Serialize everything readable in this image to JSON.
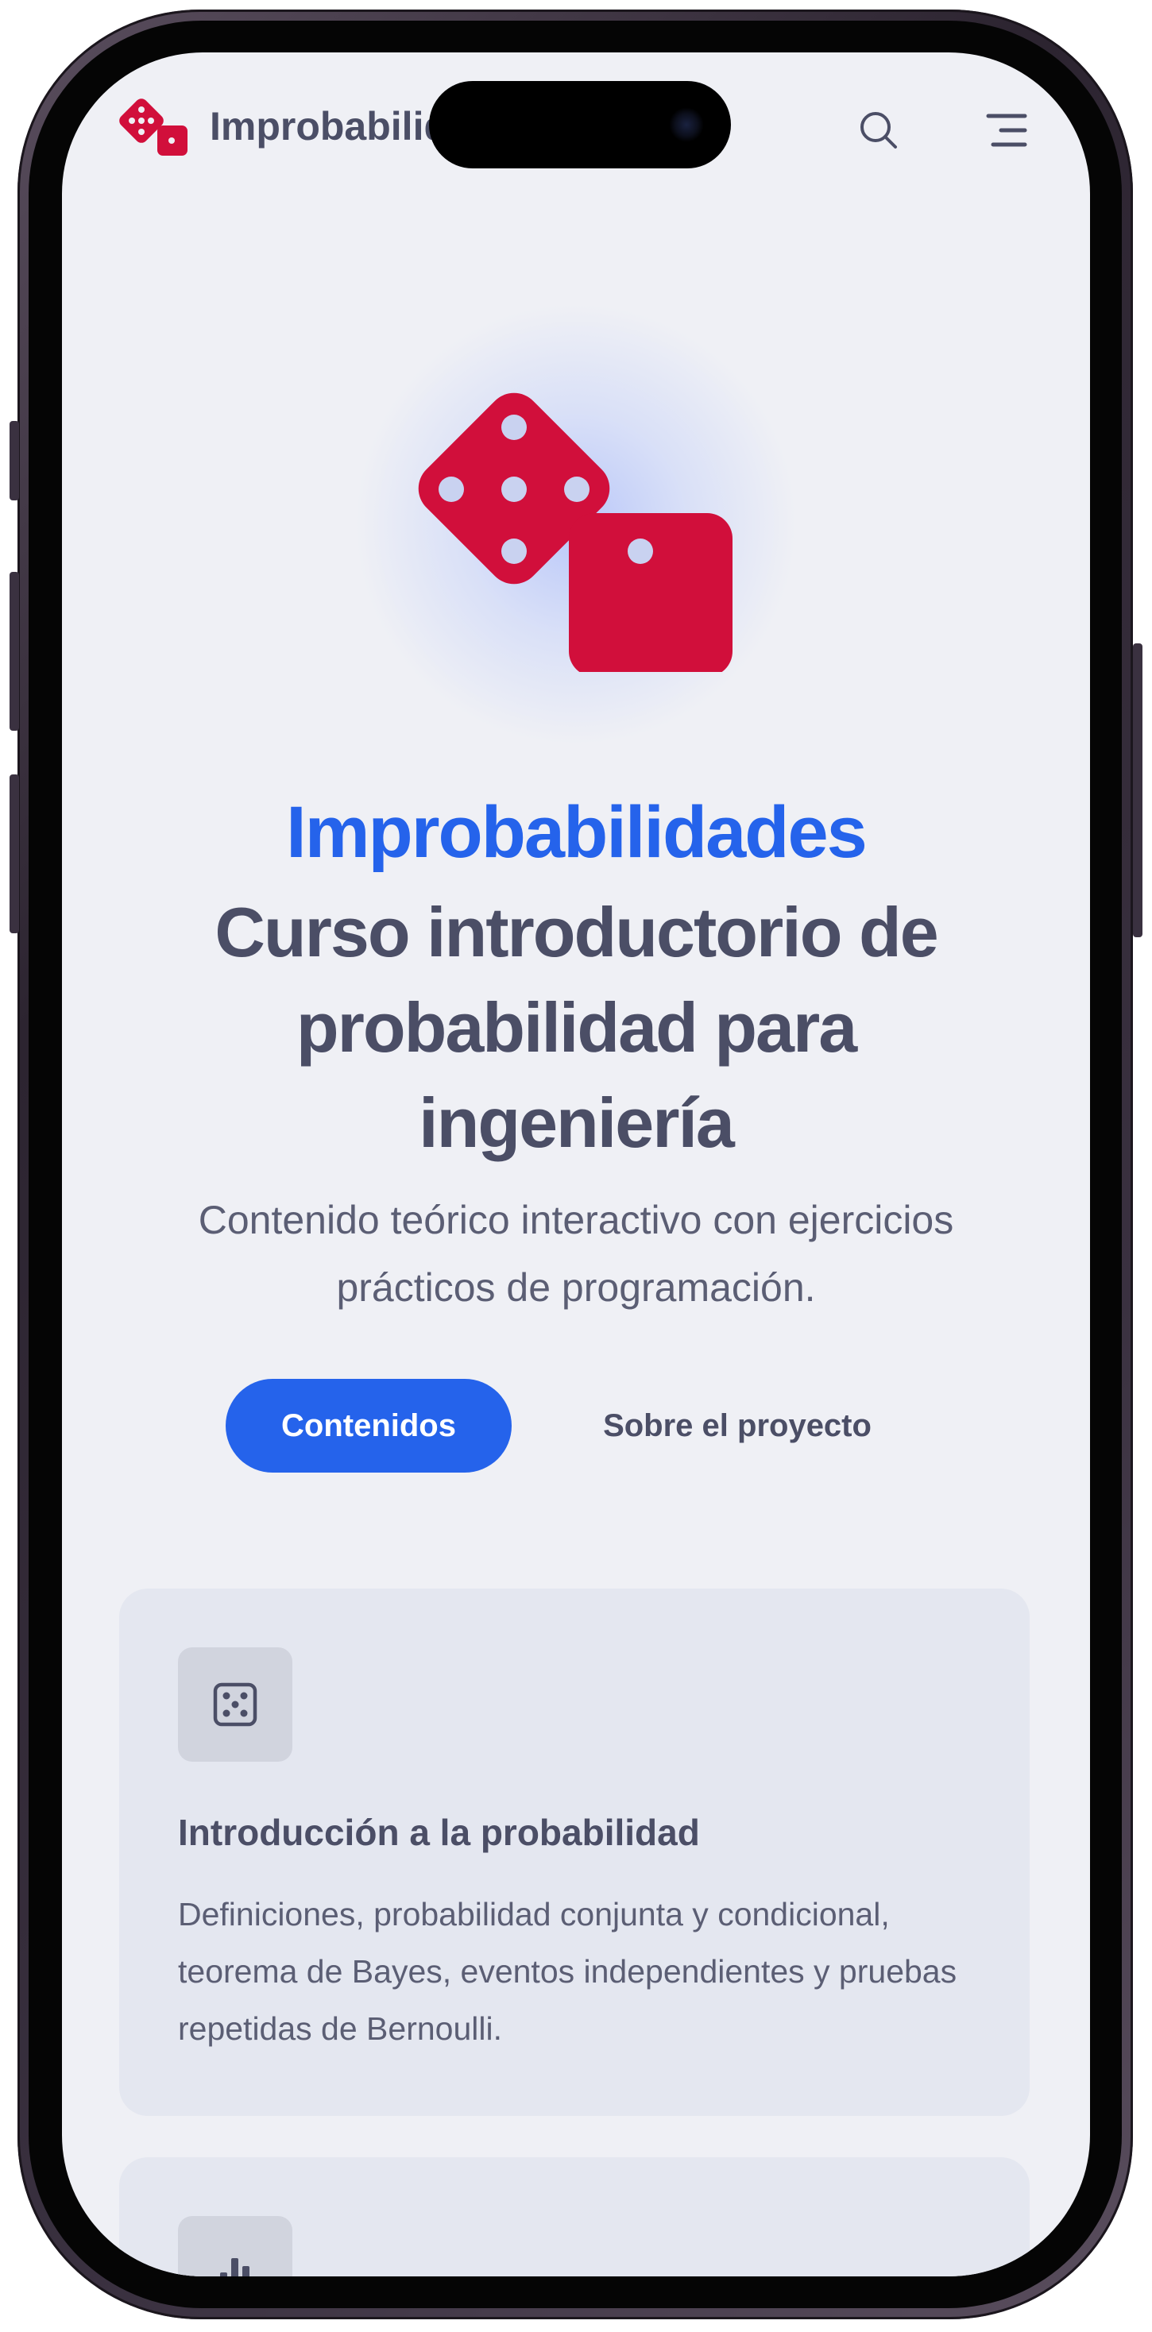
{
  "header": {
    "site_name": "Improbabilidades",
    "logo_icon": "dice-logo-icon",
    "search_icon": "search-icon",
    "menu_icon": "menu-icon"
  },
  "hero": {
    "brand": "Improbabilidades",
    "title": "Curso introductorio de probabilidad para ingeniería",
    "subtitle": "Contenido teórico interactivo con ejercicios prácticos de programación.",
    "primary_button": "Contenidos",
    "secondary_button": "Sobre el proyecto",
    "image_icon": "dice-illustration-icon"
  },
  "cards": [
    {
      "icon": "dice-five-icon",
      "title": "Introducción a la probabilidad",
      "description": "Definiciones, probabilidad conjunta y condicional, teorema de Bayes, eventos independientes y pruebas repetidas de Bernoulli."
    },
    {
      "icon": "bar-chart-icon"
    }
  ],
  "colors": {
    "accent": "#2563eb",
    "dice": "#d10f3b",
    "text": "#4b4e66",
    "background": "#eff0f5",
    "card": "#e4e7f0"
  }
}
